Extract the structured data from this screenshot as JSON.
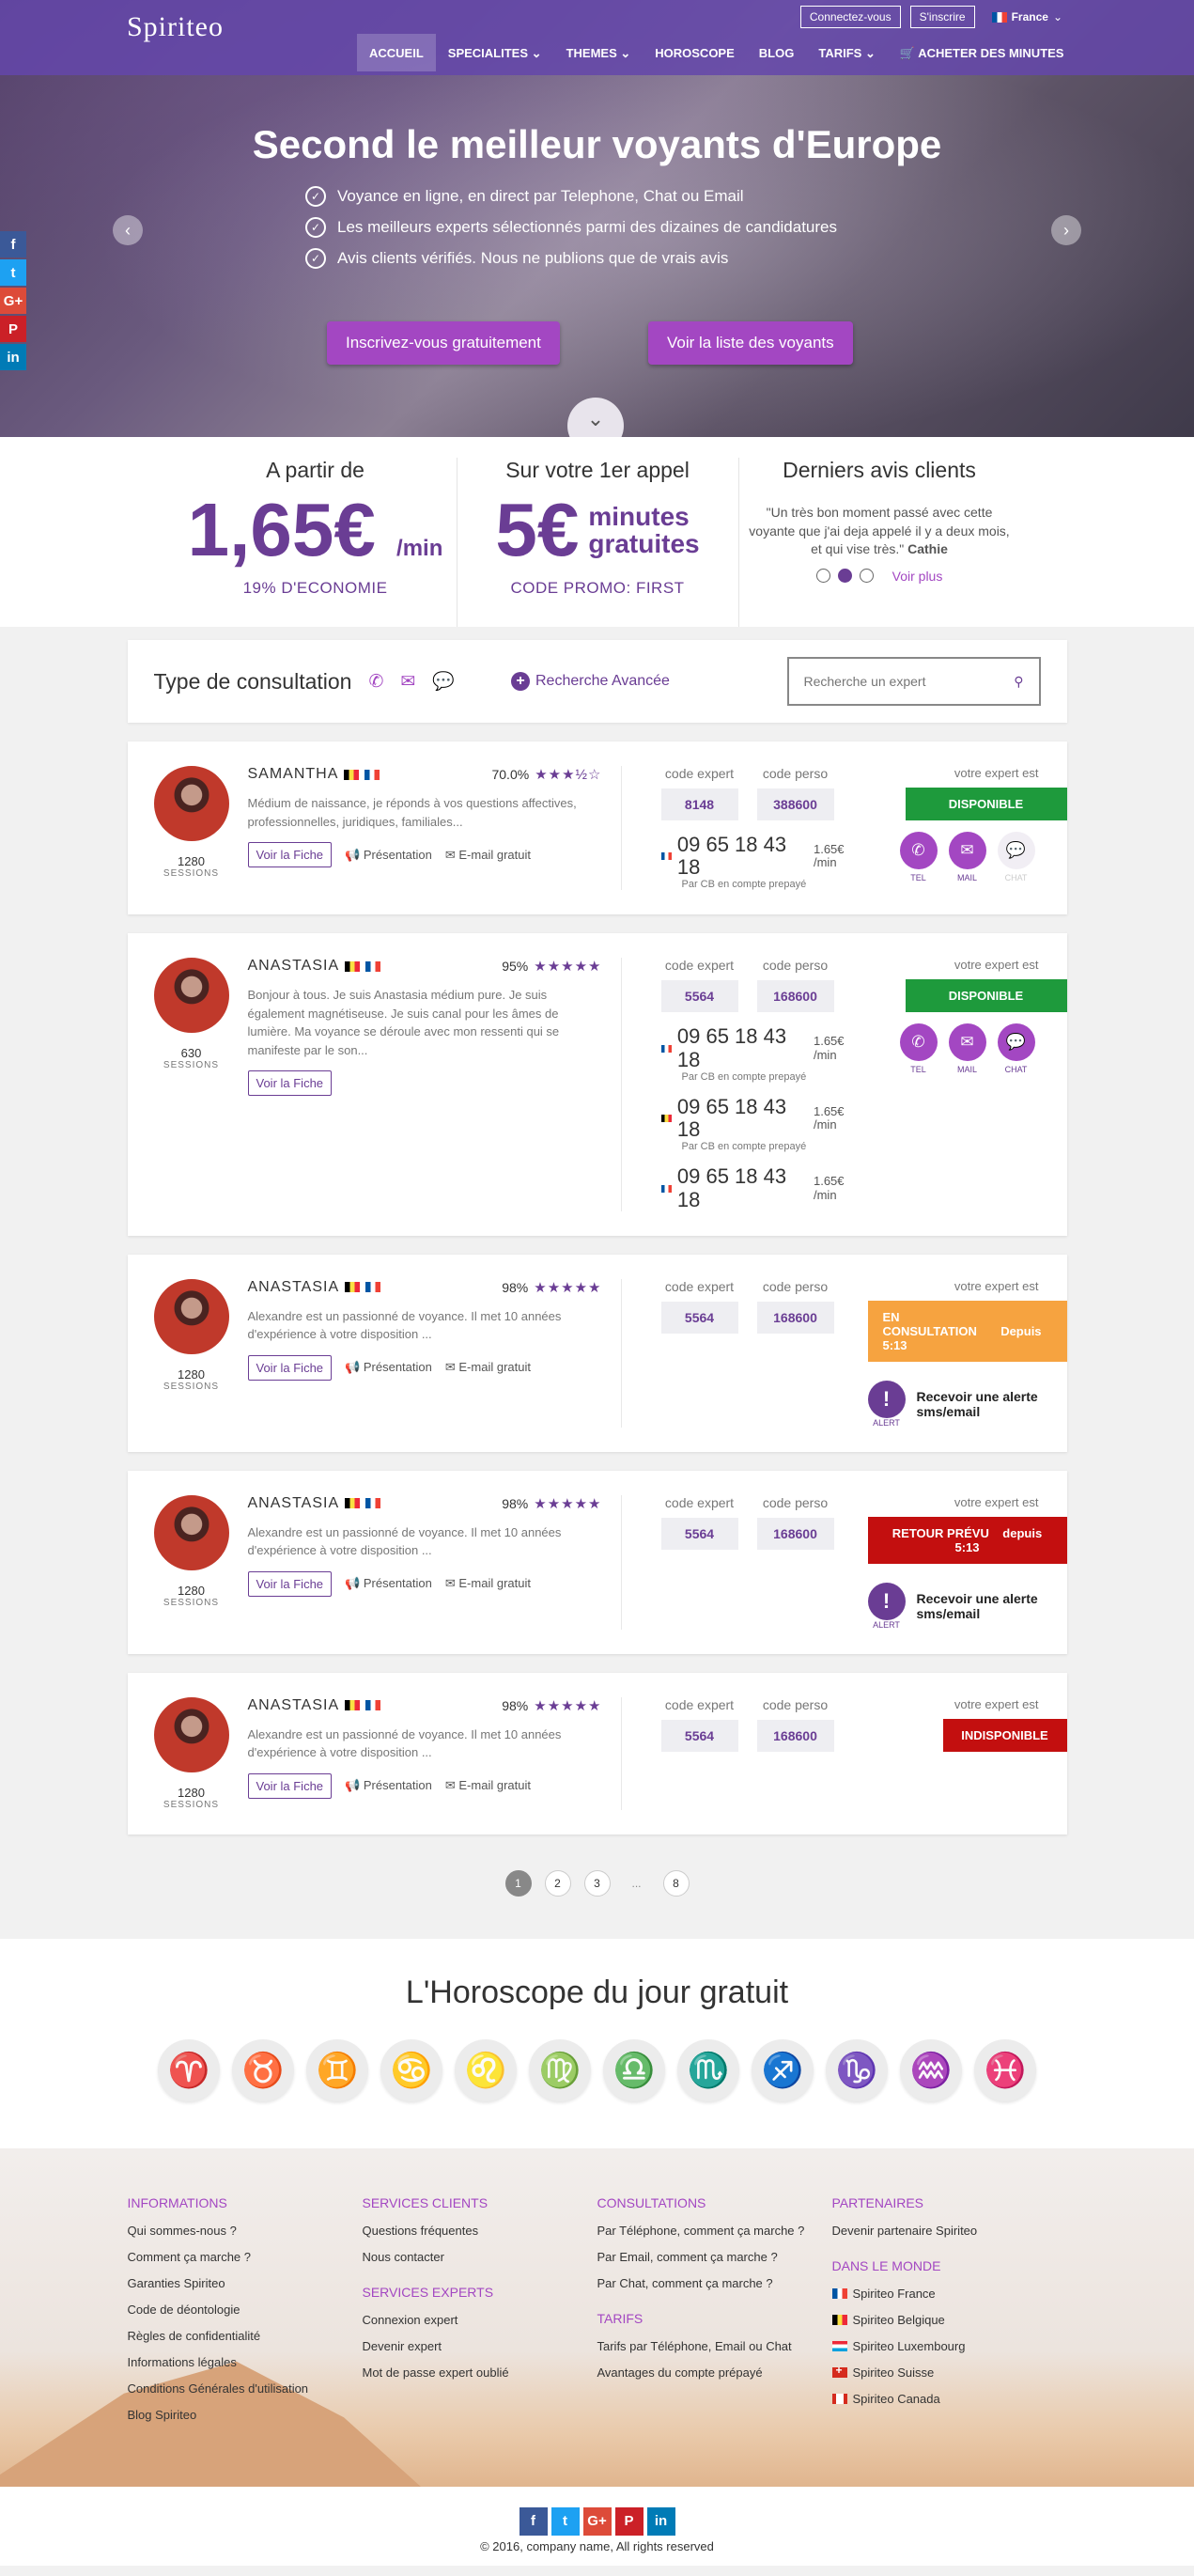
{
  "header": {
    "logo": "Spiriteo",
    "login": "Connectez-vous",
    "signup": "S'inscrire",
    "country": "France",
    "nav": [
      "ACCUEIL",
      "SPECIALITES",
      "THEMES",
      "HOROSCOPE",
      "BLOG",
      "TARIFS",
      "ACHETER DES MINUTES"
    ],
    "nav_dropdowns": [
      "",
      "⌄",
      "⌄",
      "",
      "",
      "⌄",
      ""
    ]
  },
  "hero": {
    "title": "Second le meilleur voyants d'Europe",
    "points": [
      "Voyance en ligne, en direct par Telephone, Chat ou Email",
      "Les meilleurs experts sélectionnés parmi des dizaines de candidatures",
      "Avis clients vérifiés. Nous ne publions que de vrais avis"
    ],
    "btn_register": "Inscrivez-vous gratuitement",
    "btn_list": "Voir la liste des voyants"
  },
  "social_side": [
    "f",
    "t",
    "G+",
    "P",
    "in"
  ],
  "promo": {
    "col1_title": "A partir de",
    "col1_price": "1,65€",
    "col1_unit": "/min",
    "col1_sub": "19% D'ECONOMIE",
    "col2_title": "Sur votre 1er appel",
    "col2_big": "5€",
    "col2_txt1": "minutes",
    "col2_txt2": "gratuites",
    "col2_sub": "CODE PROMO: FIRST",
    "col3_title": "Derniers avis clients",
    "col3_review": "\"Un très bon moment passé avec cette voyante que j'ai deja appelé il y a deux mois, et qui vise très.\"",
    "col3_author": "Cathie",
    "col3_more": "Voir plus"
  },
  "filter": {
    "title": "Type de consultation",
    "advanced": "Recherche Avancée",
    "search_placeholder": "Recherche un expert"
  },
  "labels": {
    "sessions": "SESSIONS",
    "fiche": "Voir la Fiche",
    "presentation": "Présentation",
    "email": "E-mail gratuit",
    "code_expert": "code expert",
    "code_perso": "code perso",
    "votre_expert": "votre expert est",
    "cb": "Par CB en compte prepayé",
    "tel": "TEL",
    "mail": "MAIL",
    "chat": "CHAT",
    "alert": "ALERT",
    "alert_text": "Recevoir une alerte sms/email",
    "rate": "1.65€ /min"
  },
  "experts": [
    {
      "name": "SAMANTHA",
      "pct": "70.0%",
      "stars": "★★★½☆",
      "sessions": "1280",
      "desc": "Médium de naissance, je réponds à vos questions affectives, professionnelles, juridiques, familiales...",
      "code_expert": "8148",
      "code_perso": "388600",
      "phone": "09 65 18 43 18",
      "status": "DISPONIBLE"
    },
    {
      "name": "ANASTASIA",
      "pct": "95%",
      "stars": "★★★★★",
      "sessions": "630",
      "desc": "Bonjour à tous. Je suis Anastasia médium pure. Je suis également magnétiseuse. Je suis canal pour les âmes de lumière. Ma voyance se déroule avec mon ressenti qui se manifeste par le son...",
      "code_expert": "5564",
      "code_perso": "168600",
      "phone": "09 65 18 43 18",
      "status": "DISPONIBLE"
    },
    {
      "name": "ANASTASIA",
      "pct": "98%",
      "stars": "★★★★★",
      "sessions": "1280",
      "desc": "Alexandre est un passionné de voyance. Il met 10 années d'expérience à votre disposition ...",
      "code_expert": "5564",
      "code_perso": "168600",
      "status": "EN CONSULTATION",
      "since": "Depuis 5:13"
    },
    {
      "name": "ANASTASIA",
      "pct": "98%",
      "stars": "★★★★★",
      "sessions": "1280",
      "desc": "Alexandre est un passionné de voyance. Il met 10 années d'expérience à votre disposition ...",
      "code_expert": "5564",
      "code_perso": "168600",
      "status": "RETOUR PRÉVU",
      "since": "depuis 5:13"
    },
    {
      "name": "ANASTASIA",
      "pct": "98%",
      "stars": "★★★★★",
      "sessions": "1280",
      "desc": "Alexandre est un passionné de voyance. Il met 10 années d'expérience à votre disposition ...",
      "code_expert": "5564",
      "code_perso": "168600",
      "status": "INDISPONIBLE"
    }
  ],
  "pagination": [
    "1",
    "2",
    "3",
    "...",
    "8"
  ],
  "horoscope": {
    "title": "L'Horoscope du jour gratuit",
    "signs": [
      "♈",
      "♉",
      "♊",
      "♋",
      "♌",
      "♍",
      "♎",
      "♏",
      "♐",
      "♑",
      "♒",
      "♓"
    ]
  },
  "footer": {
    "informations": {
      "title": "INFORMATIONS",
      "items": [
        "Qui sommes-nous ?",
        "Comment ça marche ?",
        "Garanties Spiriteo",
        "Code de déontologie",
        "Règles de confidentialité",
        "Informations légales",
        "Conditions Générales d'utilisation",
        "Blog Spiriteo"
      ]
    },
    "services_clients": {
      "title": "SERVICES CLIENTS",
      "items": [
        "Questions fréquentes",
        "Nous contacter"
      ]
    },
    "services_experts": {
      "title": "SERVICES EXPERTS",
      "items": [
        "Connexion expert",
        "Devenir expert",
        "Mot de passe expert oublié"
      ]
    },
    "consultations": {
      "title": "CONSULTATIONS",
      "items": [
        "Par Téléphone, comment ça marche ?",
        "Par Email, comment ça marche ?",
        "Par Chat, comment ça marche ?"
      ]
    },
    "tarifs": {
      "title": "TARIFS",
      "items": [
        "Tarifs par Téléphone, Email ou Chat",
        "Avantages du compte prépayé"
      ]
    },
    "partenaires": {
      "title": "PARTENAIRES",
      "items": [
        "Devenir partenaire Spiriteo"
      ]
    },
    "monde": {
      "title": "DANS LE MONDE",
      "items": [
        "Spiriteo France",
        "Spiriteo Belgique",
        "Spiriteo Luxembourg",
        "Spiriteo Suisse",
        "Spiriteo Canada"
      ]
    },
    "copyright": "© 2016, company name, All rights reserved"
  }
}
